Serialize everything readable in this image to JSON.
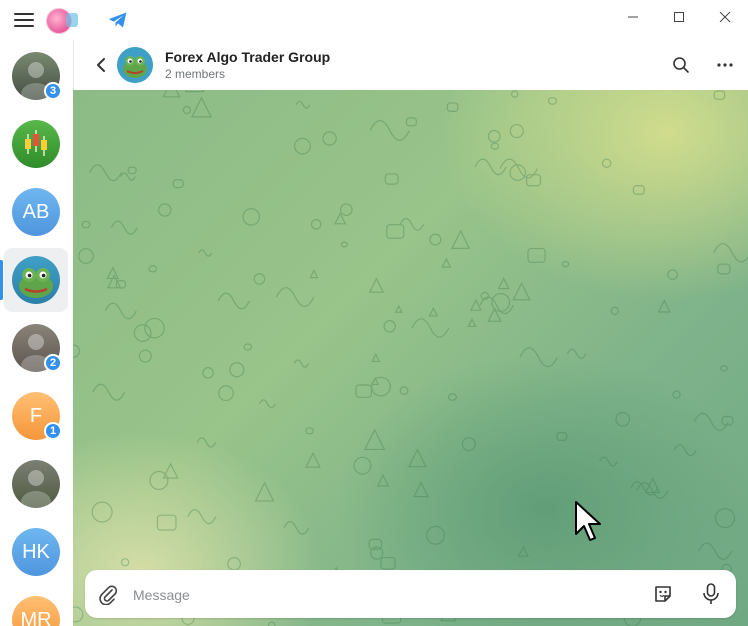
{
  "window": {
    "controls": [
      "minimize",
      "maximize",
      "close"
    ]
  },
  "sidebar": {
    "chats": [
      {
        "type": "image",
        "badge": "3",
        "colors": [
          "#7a8a70",
          "#444c44"
        ]
      },
      {
        "type": "image",
        "badge": "",
        "colors": [
          "#58b84a",
          "#2f8c2a"
        ]
      },
      {
        "type": "initials",
        "initials": "AB",
        "badge": "",
        "colors": [
          "#6fb7f0",
          "#4f95de"
        ]
      },
      {
        "type": "image",
        "badge": "",
        "active": true,
        "colors": [
          "#3fa0c7",
          "#2d7fa6"
        ]
      },
      {
        "type": "image",
        "badge": "2",
        "colors": [
          "#8a8378",
          "#5b5550"
        ]
      },
      {
        "type": "initials",
        "initials": "F",
        "badge": "1",
        "colors": [
          "#ffc074",
          "#f5963a"
        ]
      },
      {
        "type": "image",
        "badge": "",
        "colors": [
          "#7b7f74",
          "#4e5a40"
        ]
      },
      {
        "type": "initials",
        "initials": "HK",
        "badge": "",
        "colors": [
          "#6fb7f0",
          "#4f95de"
        ]
      },
      {
        "type": "initials",
        "initials": "MR",
        "badge": "",
        "colors": [
          "#ffc074",
          "#f5963a"
        ]
      }
    ]
  },
  "chat": {
    "title": "Forex Algo Trader Group",
    "subtitle": "2 members"
  },
  "composer": {
    "placeholder": "Message"
  },
  "colors": {
    "accent": "#3390ec",
    "badge": "#3390ec"
  }
}
